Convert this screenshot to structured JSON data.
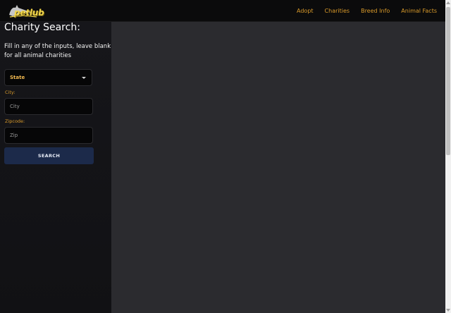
{
  "app": {
    "logo_text": "petlub"
  },
  "nav": {
    "links": [
      "Adopt",
      "Charities",
      "Breed Info",
      "Animal Facts"
    ]
  },
  "sidebar": {
    "title": "Charity Search:",
    "description": "Fill in any of the inputs, leave blank for all animal charities",
    "state_select": {
      "selected": "State"
    },
    "city": {
      "label": "City:",
      "placeholder": "City"
    },
    "zipcode": {
      "label": "Zipcode:",
      "placeholder": "Zip"
    },
    "search_button": "SEARCH"
  },
  "colors": {
    "accent": "#d99a2a",
    "button_bg": "#1c2a4a",
    "sidebar_bg": "#141417",
    "main_bg": "#2b2b2f"
  }
}
